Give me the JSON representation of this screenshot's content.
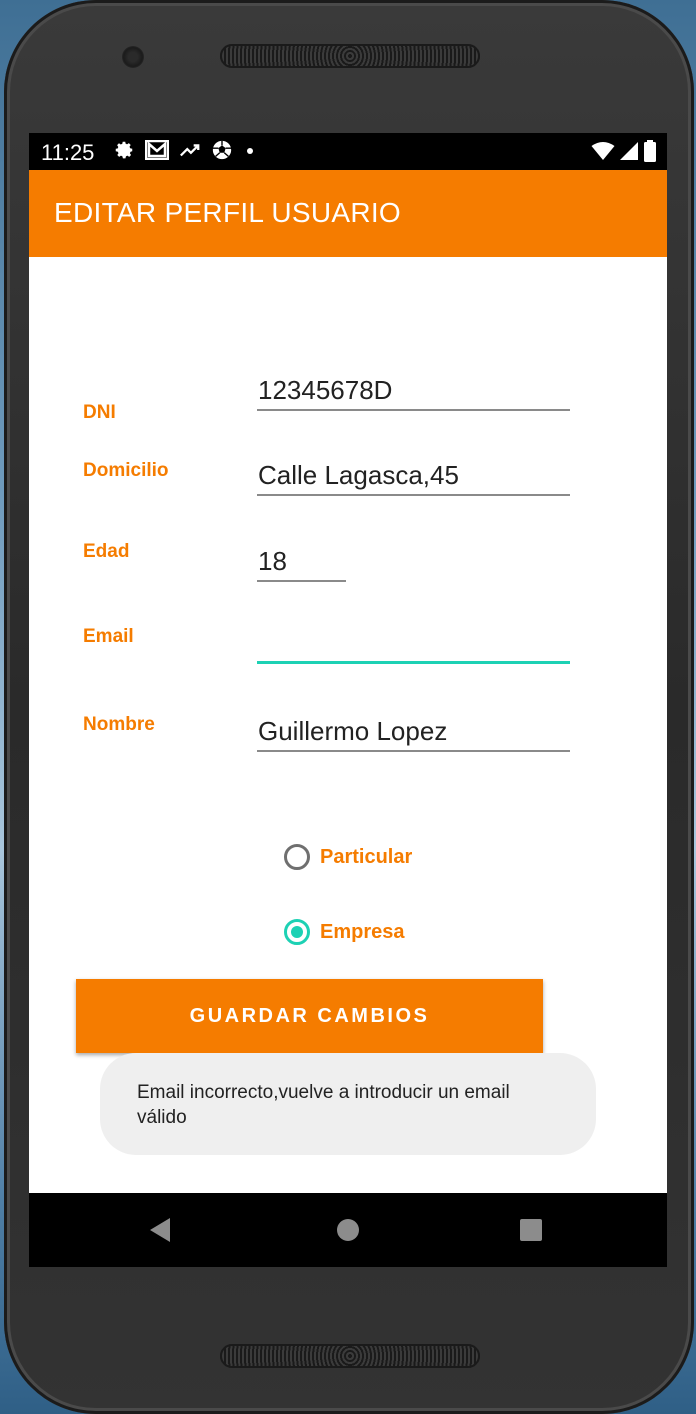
{
  "status_bar": {
    "time": "11:25",
    "left_icons": [
      "gear-icon",
      "gmail-icon",
      "trending-up-icon",
      "soccer-ball-icon",
      "dot-icon"
    ],
    "right_icons": [
      "wifi-icon",
      "signal-icon",
      "battery-icon"
    ]
  },
  "app_bar": {
    "title": "EDITAR PERFIL USUARIO"
  },
  "form": {
    "dni": {
      "label": "DNI",
      "value": "12345678D"
    },
    "domicilio": {
      "label": "Domicilio",
      "value": "Calle Lagasca,45"
    },
    "edad": {
      "label": "Edad",
      "value": "18"
    },
    "email": {
      "label": "Email",
      "value": ""
    },
    "nombre": {
      "label": "Nombre",
      "value": "Guillermo Lopez"
    }
  },
  "radio_group": {
    "options": [
      {
        "label": "Particular",
        "checked": false
      },
      {
        "label": "Empresa",
        "checked": true
      }
    ]
  },
  "save_button": {
    "label": "GUARDAR CAMBIOS"
  },
  "toast": {
    "message": "Email incorrecto,vuelve a introducir un email válido"
  },
  "colors": {
    "accent": "#f57c00",
    "focus": "#1dd1b4",
    "toast_bg": "#efefef"
  },
  "nav_bar": {
    "buttons": [
      "back-icon",
      "home-icon",
      "recents-icon"
    ]
  }
}
